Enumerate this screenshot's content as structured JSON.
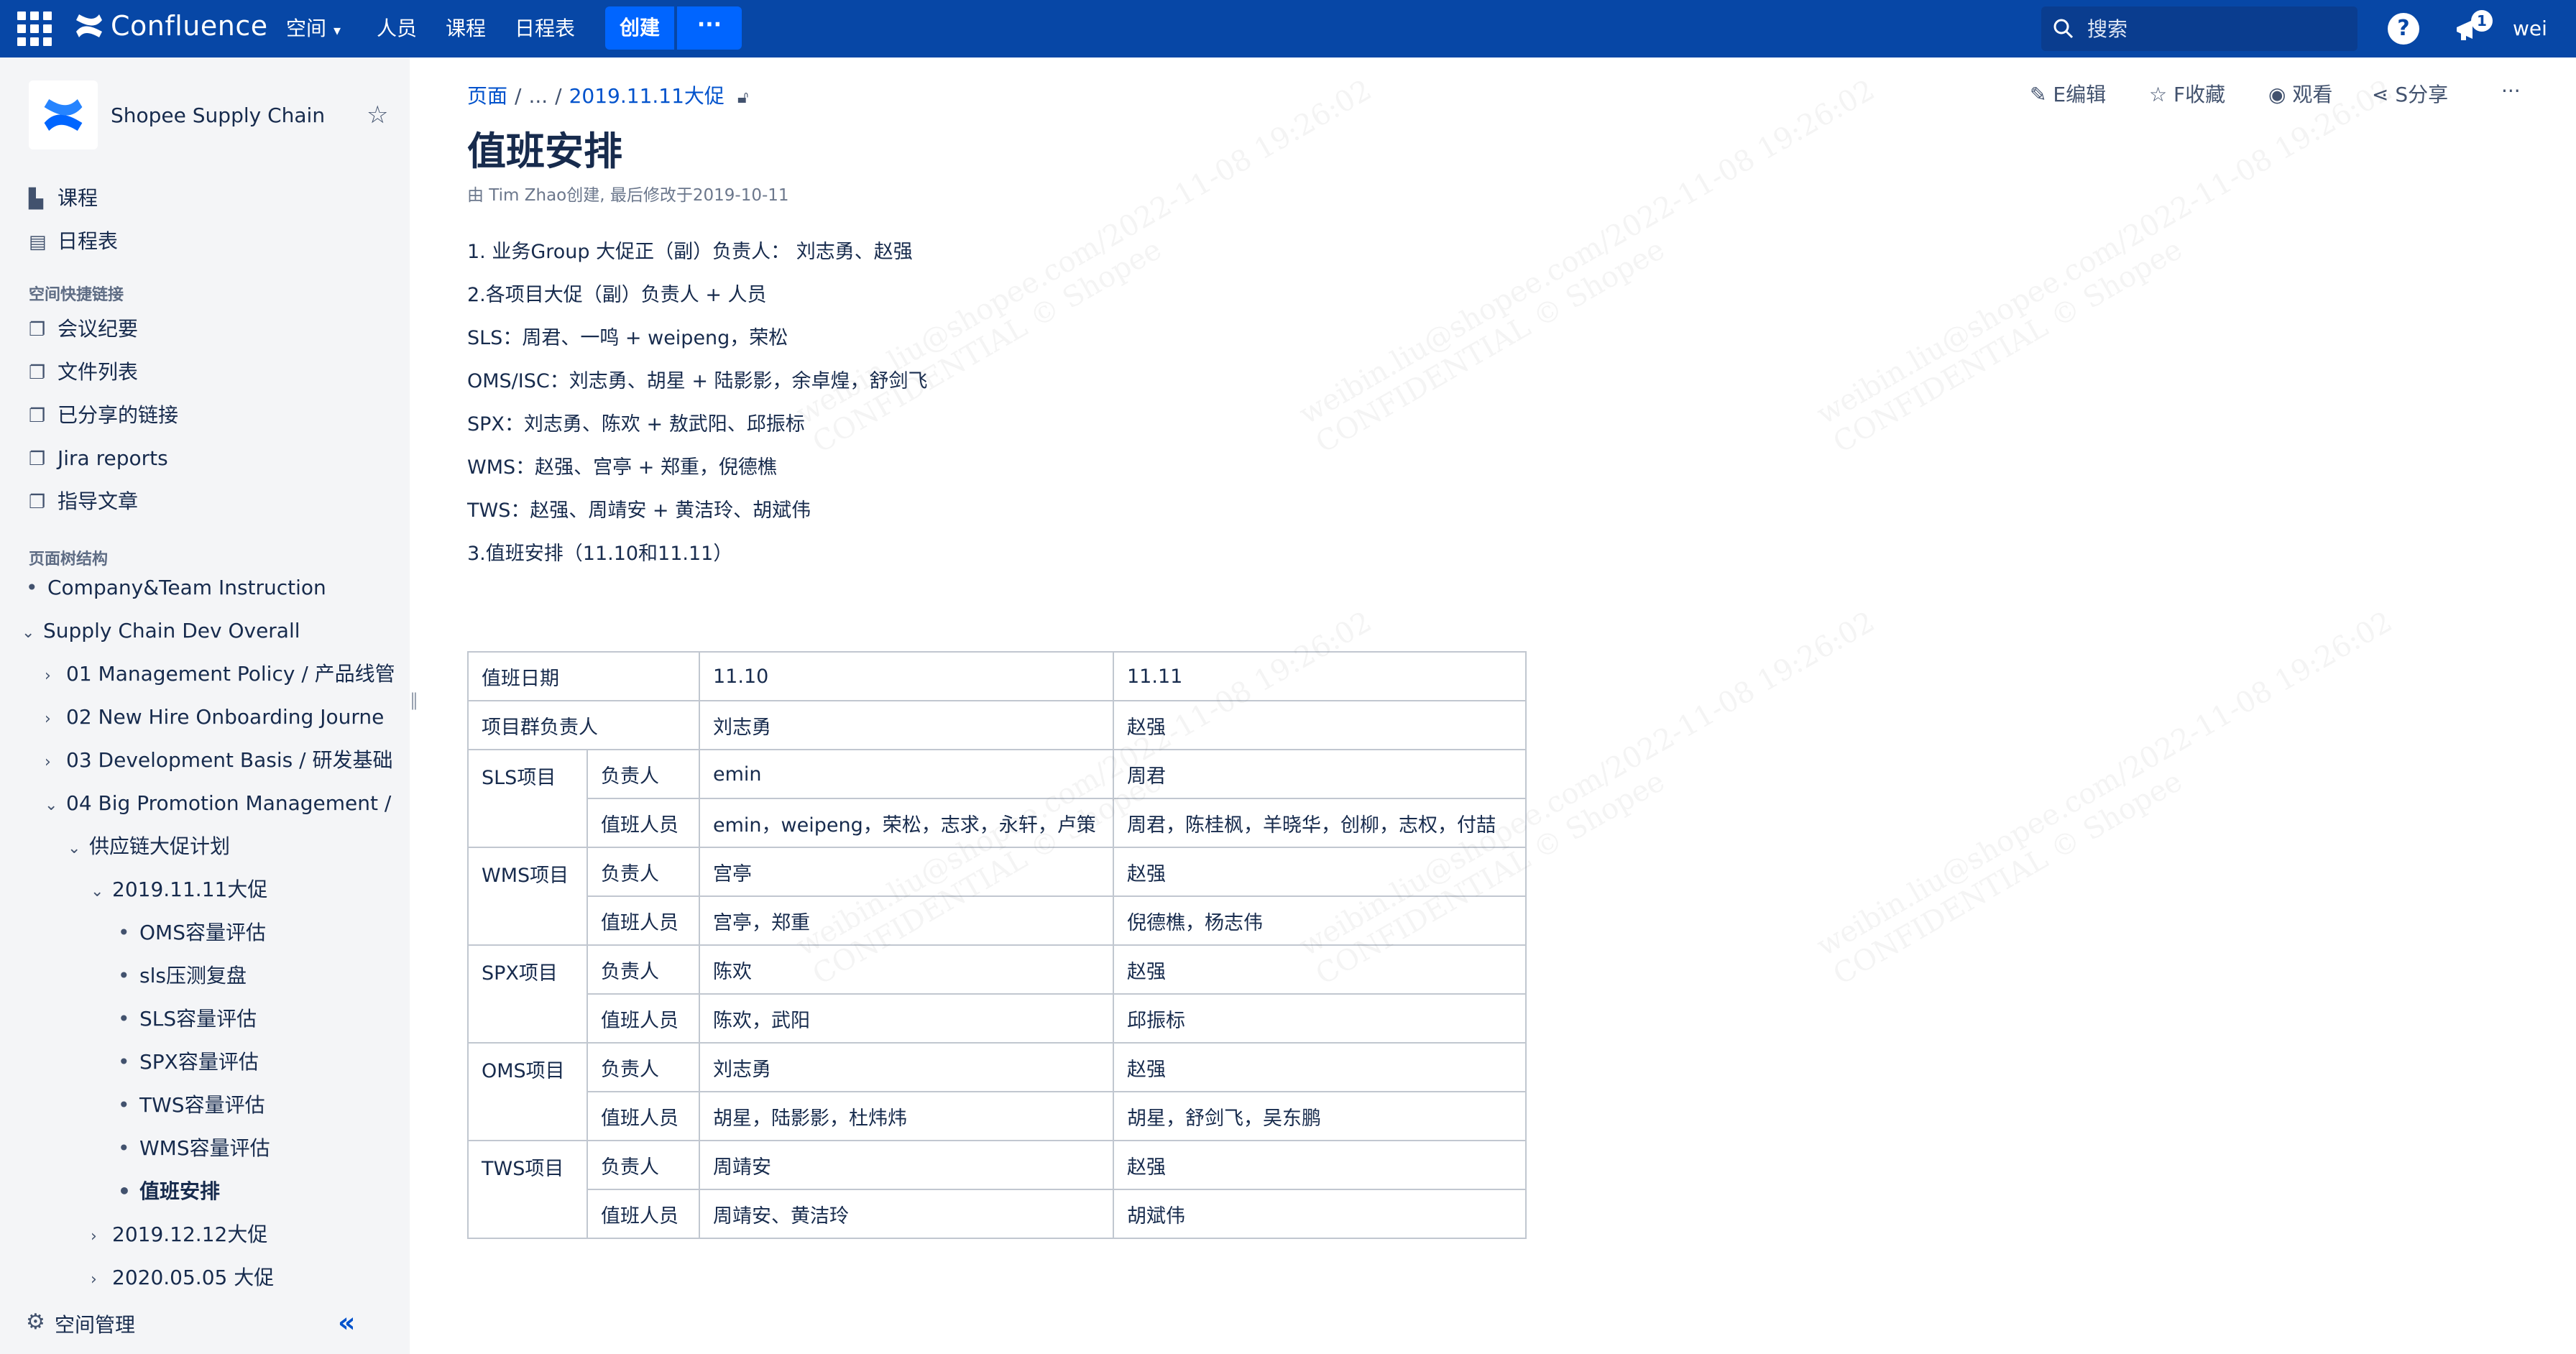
{
  "topnav": {
    "brand": "Confluence",
    "items": [
      "空间",
      "人员",
      "课程",
      "日程表"
    ],
    "create": "创建",
    "more": "···",
    "search_placeholder": "搜索",
    "help": "?",
    "notification_count": "1",
    "user": "wei"
  },
  "sidebar": {
    "space_name": "Shopee Supply Chain",
    "main_links": [
      {
        "label": "课程",
        "icon": "course-icon"
      },
      {
        "label": "日程表",
        "icon": "calendar-icon"
      }
    ],
    "shortcuts_title": "空间快捷链接",
    "shortcuts": [
      "会议纪要",
      "文件列表",
      "已分享的链接",
      "Jira reports",
      "指导文章"
    ],
    "tree_title": "页面树结构",
    "tree": [
      {
        "label": "Company&Team Instruction",
        "marker": "•"
      },
      {
        "label": "Supply Chain Dev Overall",
        "marker": "⌄"
      },
      {
        "label": "01 Management Policy / 产品线管",
        "marker": "›"
      },
      {
        "label": "02 New Hire Onboarding Journe",
        "marker": "›"
      },
      {
        "label": "03 Development Basis / 研发基础",
        "marker": "›"
      },
      {
        "label": "04 Big Promotion Management /",
        "marker": "⌄"
      },
      {
        "label": "供应链大促计划",
        "marker": "⌄"
      },
      {
        "label": "2019.11.11大促",
        "marker": "⌄"
      },
      {
        "label": "OMS容量评估",
        "marker": "•"
      },
      {
        "label": "sls压测复盘",
        "marker": "•"
      },
      {
        "label": "SLS容量评估",
        "marker": "•"
      },
      {
        "label": "SPX容量评估",
        "marker": "•"
      },
      {
        "label": "TWS容量评估",
        "marker": "•"
      },
      {
        "label": "WMS容量评估",
        "marker": "•"
      },
      {
        "label": "值班安排",
        "marker": "•"
      },
      {
        "label": "2019.12.12大促",
        "marker": "›"
      },
      {
        "label": "2020.05.05 大促",
        "marker": "›"
      }
    ],
    "footer": "空间管理"
  },
  "page": {
    "breadcrumb": [
      "页面",
      "...",
      "2019.11.11大促"
    ],
    "actions": {
      "edit": "E编辑",
      "save": "F收藏",
      "watch": "观看",
      "share": "S分享",
      "more": "···"
    },
    "title": "值班安排",
    "byline": "由 Tim Zhao创建, 最后修改于2019-10-11",
    "paragraphs": [
      "1. 业务Group 大促正（副）负责人：  刘志勇、赵强",
      "2.各项目大促（副）负责人 + 人员",
      "SLS：周君、一鸣 + weipeng，荣松",
      "OMS/ISC：刘志勇、胡星 + 陆影影，余卓煌，舒剑飞",
      "SPX：刘志勇、陈欢 + 敖武阳、邱振标",
      "WMS：赵强、宫亭 + 郑重，倪德樵",
      "TWS：赵强、周靖安 + 黄洁玲、胡斌伟",
      "3.值班安排（11.10和11.11）"
    ],
    "table": {
      "header": {
        "label": "值班日期",
        "d1": "11.10",
        "d2": "11.11"
      },
      "group_lead": {
        "label": "项目群负责人",
        "d1": "刘志勇",
        "d2": "赵强"
      },
      "projects": [
        {
          "name": "SLS项目",
          "lead_label": "负责人",
          "lead_d1": "emin",
          "lead_d2": "周君",
          "staff_label": "值班人员",
          "staff_d1": "emin，weipeng，荣松，志求，永轩，卢策",
          "staff_d2": "周君，陈桂枫，羊晓华，创柳，志权，付喆"
        },
        {
          "name": "WMS项目",
          "lead_label": "负责人",
          "lead_d1": "宫亭",
          "lead_d2": "赵强",
          "staff_label": "值班人员",
          "staff_d1": "宫亭，郑重",
          "staff_d2": "倪德樵，杨志伟"
        },
        {
          "name": "SPX项目",
          "lead_label": "负责人",
          "lead_d1": "陈欢",
          "lead_d2": "赵强",
          "staff_label": "值班人员",
          "staff_d1": "陈欢，武阳",
          "staff_d2": "邱振标"
        },
        {
          "name": "OMS项目",
          "lead_label": "负责人",
          "lead_d1": "刘志勇",
          "lead_d2": "赵强",
          "staff_label": "值班人员",
          "staff_d1": "胡星，陆影影，杜炜炜",
          "staff_d2": "胡星，舒剑飞，吴东鹏"
        },
        {
          "name": "TWS项目",
          "lead_label": "负责人",
          "lead_d1": "周靖安",
          "lead_d2": "赵强",
          "staff_label": "值班人员",
          "staff_d1": "周靖安、黄洁玲",
          "staff_d2": "胡斌伟"
        }
      ]
    }
  },
  "watermark": {
    "line1": "weibin.liu@shopee.com/2022-11-08 19:26:02",
    "line2": "CONFIDENTIAL © Shopee"
  },
  "colors": {
    "nav_bg": "#0747a6",
    "create_btn": "#0065ff",
    "link": "#0052cc",
    "sidebar_bg": "#f4f5f7"
  }
}
